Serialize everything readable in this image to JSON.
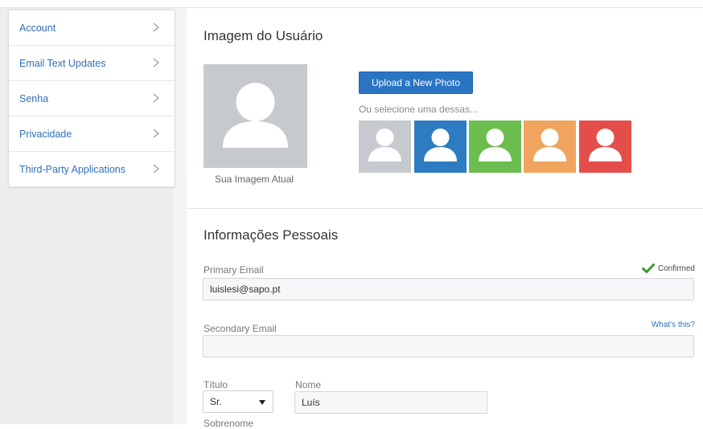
{
  "sidebar": {
    "items": [
      {
        "label": "Account"
      },
      {
        "label": "Email Text Updates"
      },
      {
        "label": "Senha"
      },
      {
        "label": "Privacidade"
      },
      {
        "label": "Third-Party Applications"
      }
    ]
  },
  "user_image": {
    "title": "Imagem do Usuário",
    "current_caption": "Sua Imagem Atual",
    "upload_label": "Upload a New Photo",
    "choose_hint": "Ou selecione uma dessas...",
    "avatar_colors": [
      "#c6c9ce",
      "#2d7bc0",
      "#6bbd4f",
      "#f0a45e",
      "#e34e4b"
    ]
  },
  "personal": {
    "title": "Informações Pessoais",
    "primary_email": {
      "label": "Primary Email",
      "value": "luislesi@sapo.pt",
      "status": "Confirmed"
    },
    "secondary_email": {
      "label": "Secondary Email",
      "value": "",
      "help": "What's this?"
    },
    "title_field": {
      "label": "Título",
      "value": "Sr."
    },
    "first_name": {
      "label": "Nome",
      "value": "Luís"
    },
    "last_name": {
      "label": "Sobrenome"
    }
  },
  "colors": {
    "link": "#2f6fb8",
    "primary_button": "#2b74c4",
    "confirmed": "#3a9a2a"
  }
}
